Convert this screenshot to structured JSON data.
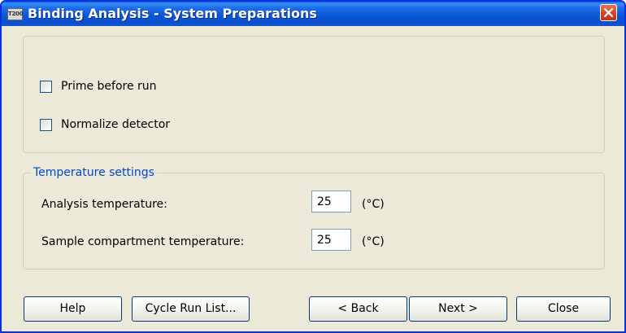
{
  "window": {
    "title": "Binding Analysis - System Preparations",
    "app_icon_text": "T200",
    "close_icon": "close-icon"
  },
  "options": {
    "prime_before_run": {
      "label": "Prime before run",
      "checked": false
    },
    "normalize_detector": {
      "label": "Normalize detector",
      "checked": false
    }
  },
  "temperature": {
    "group_title": "Temperature settings",
    "analysis": {
      "label": "Analysis temperature:",
      "value": "25",
      "unit": "(°C)"
    },
    "sample_compartment": {
      "label": "Sample compartment temperature:",
      "value": "25",
      "unit": "(°C)"
    }
  },
  "buttons": {
    "help": "Help",
    "cycle_run_list": "Cycle Run List...",
    "back": "< Back",
    "next": "Next >",
    "close": "Close"
  }
}
